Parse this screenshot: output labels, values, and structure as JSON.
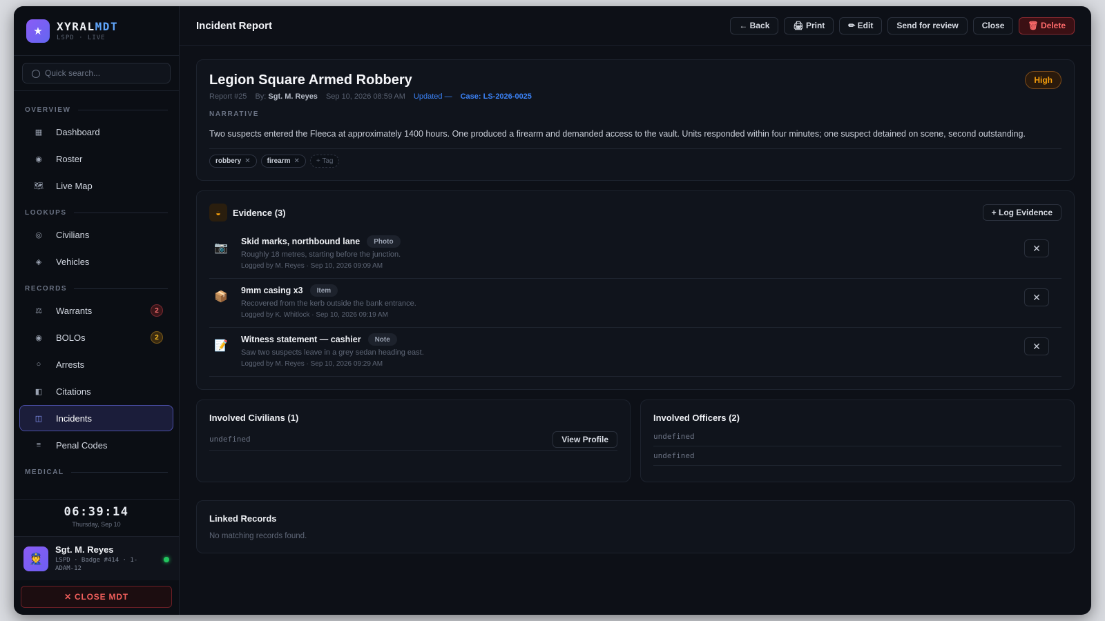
{
  "brand": {
    "name_main": "XYRAL",
    "name_accent": "MDT",
    "sub": "LSPD · LIVE"
  },
  "search": {
    "placeholder": "Quick search..."
  },
  "nav": {
    "sections": [
      {
        "label": "OVERVIEW"
      },
      {
        "label": "LOOKUPS"
      },
      {
        "label": "RECORDS"
      },
      {
        "label": "MEDICAL"
      }
    ],
    "items": [
      {
        "label": "Dashboard",
        "icon": "grid-icon",
        "glyph": "▦"
      },
      {
        "label": "Roster",
        "icon": "roster-icon",
        "glyph": "◉"
      },
      {
        "label": "Live Map",
        "icon": "map-icon",
        "glyph": "🗺"
      },
      {
        "label": "Civilians",
        "icon": "civilians-icon",
        "glyph": "◎"
      },
      {
        "label": "Vehicles",
        "icon": "vehicle-icon",
        "glyph": "◈"
      },
      {
        "label": "Warrants",
        "icon": "scales-icon",
        "glyph": "⚖",
        "badge": "2"
      },
      {
        "label": "BOLOs",
        "icon": "target-icon",
        "glyph": "◉",
        "badge": "2"
      },
      {
        "label": "Arrests",
        "icon": "circle-icon",
        "glyph": "○"
      },
      {
        "label": "Citations",
        "icon": "ticket-icon",
        "glyph": "◧"
      },
      {
        "label": "Incidents",
        "icon": "incident-icon",
        "glyph": "◫"
      },
      {
        "label": "Penal Codes",
        "icon": "list-icon",
        "glyph": "≡"
      }
    ]
  },
  "clock": {
    "time": "06:39:14",
    "date": "Thursday, Sep 10"
  },
  "user": {
    "name": "Sgt. M. Reyes",
    "meta": "LSPD · Badge #414 · 1-ADAM-12",
    "avatar": "👮"
  },
  "close_mdt": "✕ CLOSE MDT",
  "topbar": {
    "title": "Incident Report",
    "actions": {
      "back": "← Back",
      "print": "🖨 Print",
      "edit": "✏ Edit",
      "review": "Send for review",
      "close": "Close",
      "delete": "🗑 Delete"
    }
  },
  "report": {
    "title": "Legion Square Armed Robbery",
    "number": "Report #25",
    "by_label": "By:",
    "by_name": "Sgt. M. Reyes",
    "date": "Sep 10, 2026 08:59 AM",
    "updated": "Updated —",
    "case": "Case: LS-2026-0025",
    "priority": "High",
    "narrative_label": "NARRATIVE",
    "narrative": "Two suspects entered the Fleeca at approximately 1400 hours. One produced a firearm and demanded access to the vault. Units responded within four minutes; one suspect detained on scene, second outstanding.",
    "tags": [
      "robbery",
      "firearm"
    ],
    "add_tag": "+ Tag"
  },
  "evidence": {
    "title": "Evidence (3)",
    "log_button": "+ Log Evidence",
    "items": [
      {
        "icon": "camera-icon",
        "glyph": "📷",
        "title": "Skid marks, northbound lane",
        "type": "Photo",
        "desc": "Roughly 18 metres, starting before the junction.",
        "logged": "Logged by M. Reyes · Sep 10, 2026 09:09 AM"
      },
      {
        "icon": "package-icon",
        "glyph": "📦",
        "title": "9mm casing x3",
        "type": "Item",
        "desc": "Recovered from the kerb outside the bank entrance.",
        "logged": "Logged by K. Whitlock · Sep 10, 2026 09:19 AM"
      },
      {
        "icon": "note-icon",
        "glyph": "📝",
        "title": "Witness statement — cashier",
        "type": "Note",
        "desc": "Saw two suspects leave in a grey sedan heading east.",
        "logged": "Logged by M. Reyes · Sep 10, 2026 09:29 AM"
      }
    ]
  },
  "civilians": {
    "title": "Involved Civilians (1)",
    "rows": [
      "undefined"
    ],
    "view_label": "View Profile"
  },
  "officers": {
    "title": "Involved Officers (2)",
    "rows": [
      "undefined",
      "undefined"
    ]
  },
  "linked": {
    "title": "Linked Records",
    "empty": "No matching records found."
  }
}
